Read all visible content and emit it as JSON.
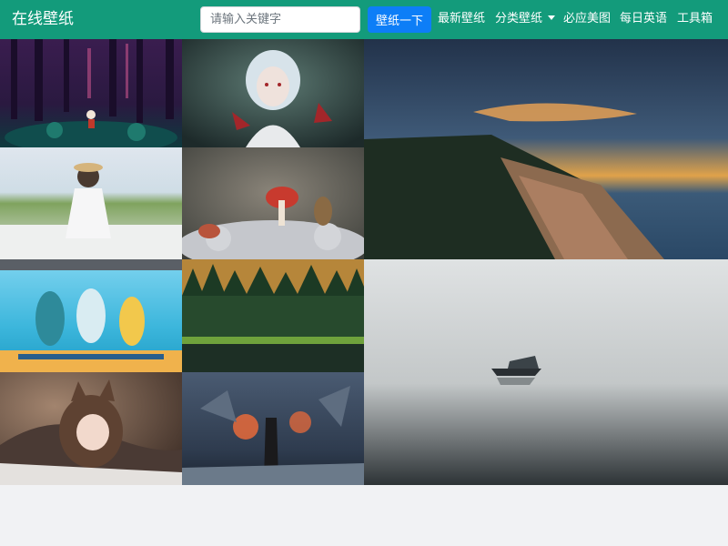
{
  "brand": "在线壁纸",
  "search": {
    "placeholder": "请输入关键字",
    "button_label": "壁纸一下"
  },
  "nav": {
    "latest": "最新壁纸",
    "categories": "分类壁纸",
    "bing": "必应美图",
    "daily_english": "每日英语",
    "toolbox": "工具箱"
  },
  "colors": {
    "navbar": "#139b7b",
    "search_button": "#0d7ef7",
    "page_background": "#f1f2f4"
  },
  "icons": {
    "categories_dropdown": "chevron-down-icon"
  }
}
